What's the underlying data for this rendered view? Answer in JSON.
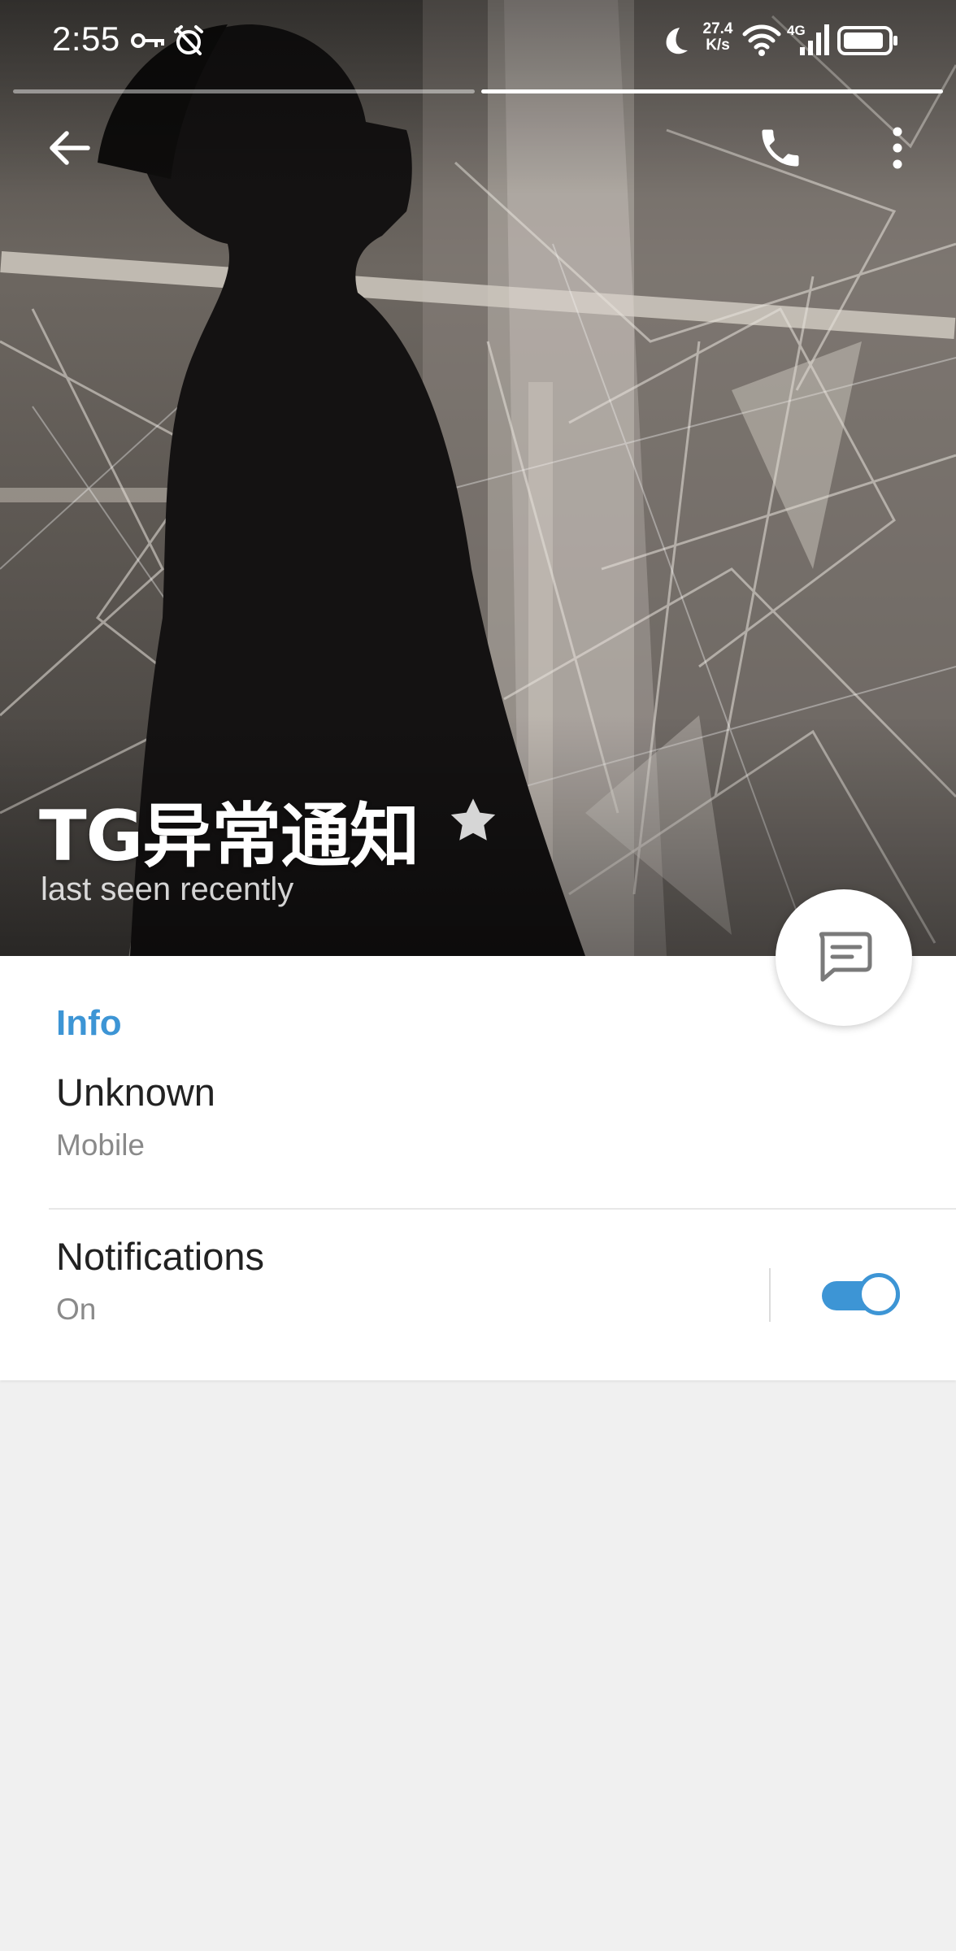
{
  "status_bar": {
    "time": "2:55",
    "net_speed_value": "27.4",
    "net_speed_unit": "K/s",
    "network_type": "4G",
    "icons": [
      "key-icon",
      "alarm-off-icon",
      "moon-icon",
      "wifi-icon",
      "signal-icon",
      "battery-icon"
    ]
  },
  "story": {
    "segments": 2,
    "current_segment": 2
  },
  "header": {
    "back_icon": "arrow-left-icon",
    "call_icon": "phone-icon",
    "menu_icon": "more-vertical-icon"
  },
  "profile": {
    "name": "TG异常通知",
    "status": "last seen recently",
    "badge_icon": "star-icon"
  },
  "fab": {
    "icon": "message-icon"
  },
  "info": {
    "section_title": "Info",
    "phone_value": "Unknown",
    "phone_label": "Mobile",
    "notifications_title": "Notifications",
    "notifications_state": "On",
    "notifications_enabled": true
  },
  "colors": {
    "accent": "#3d95d5",
    "background": "#f0f0f0",
    "card": "#ffffff"
  }
}
